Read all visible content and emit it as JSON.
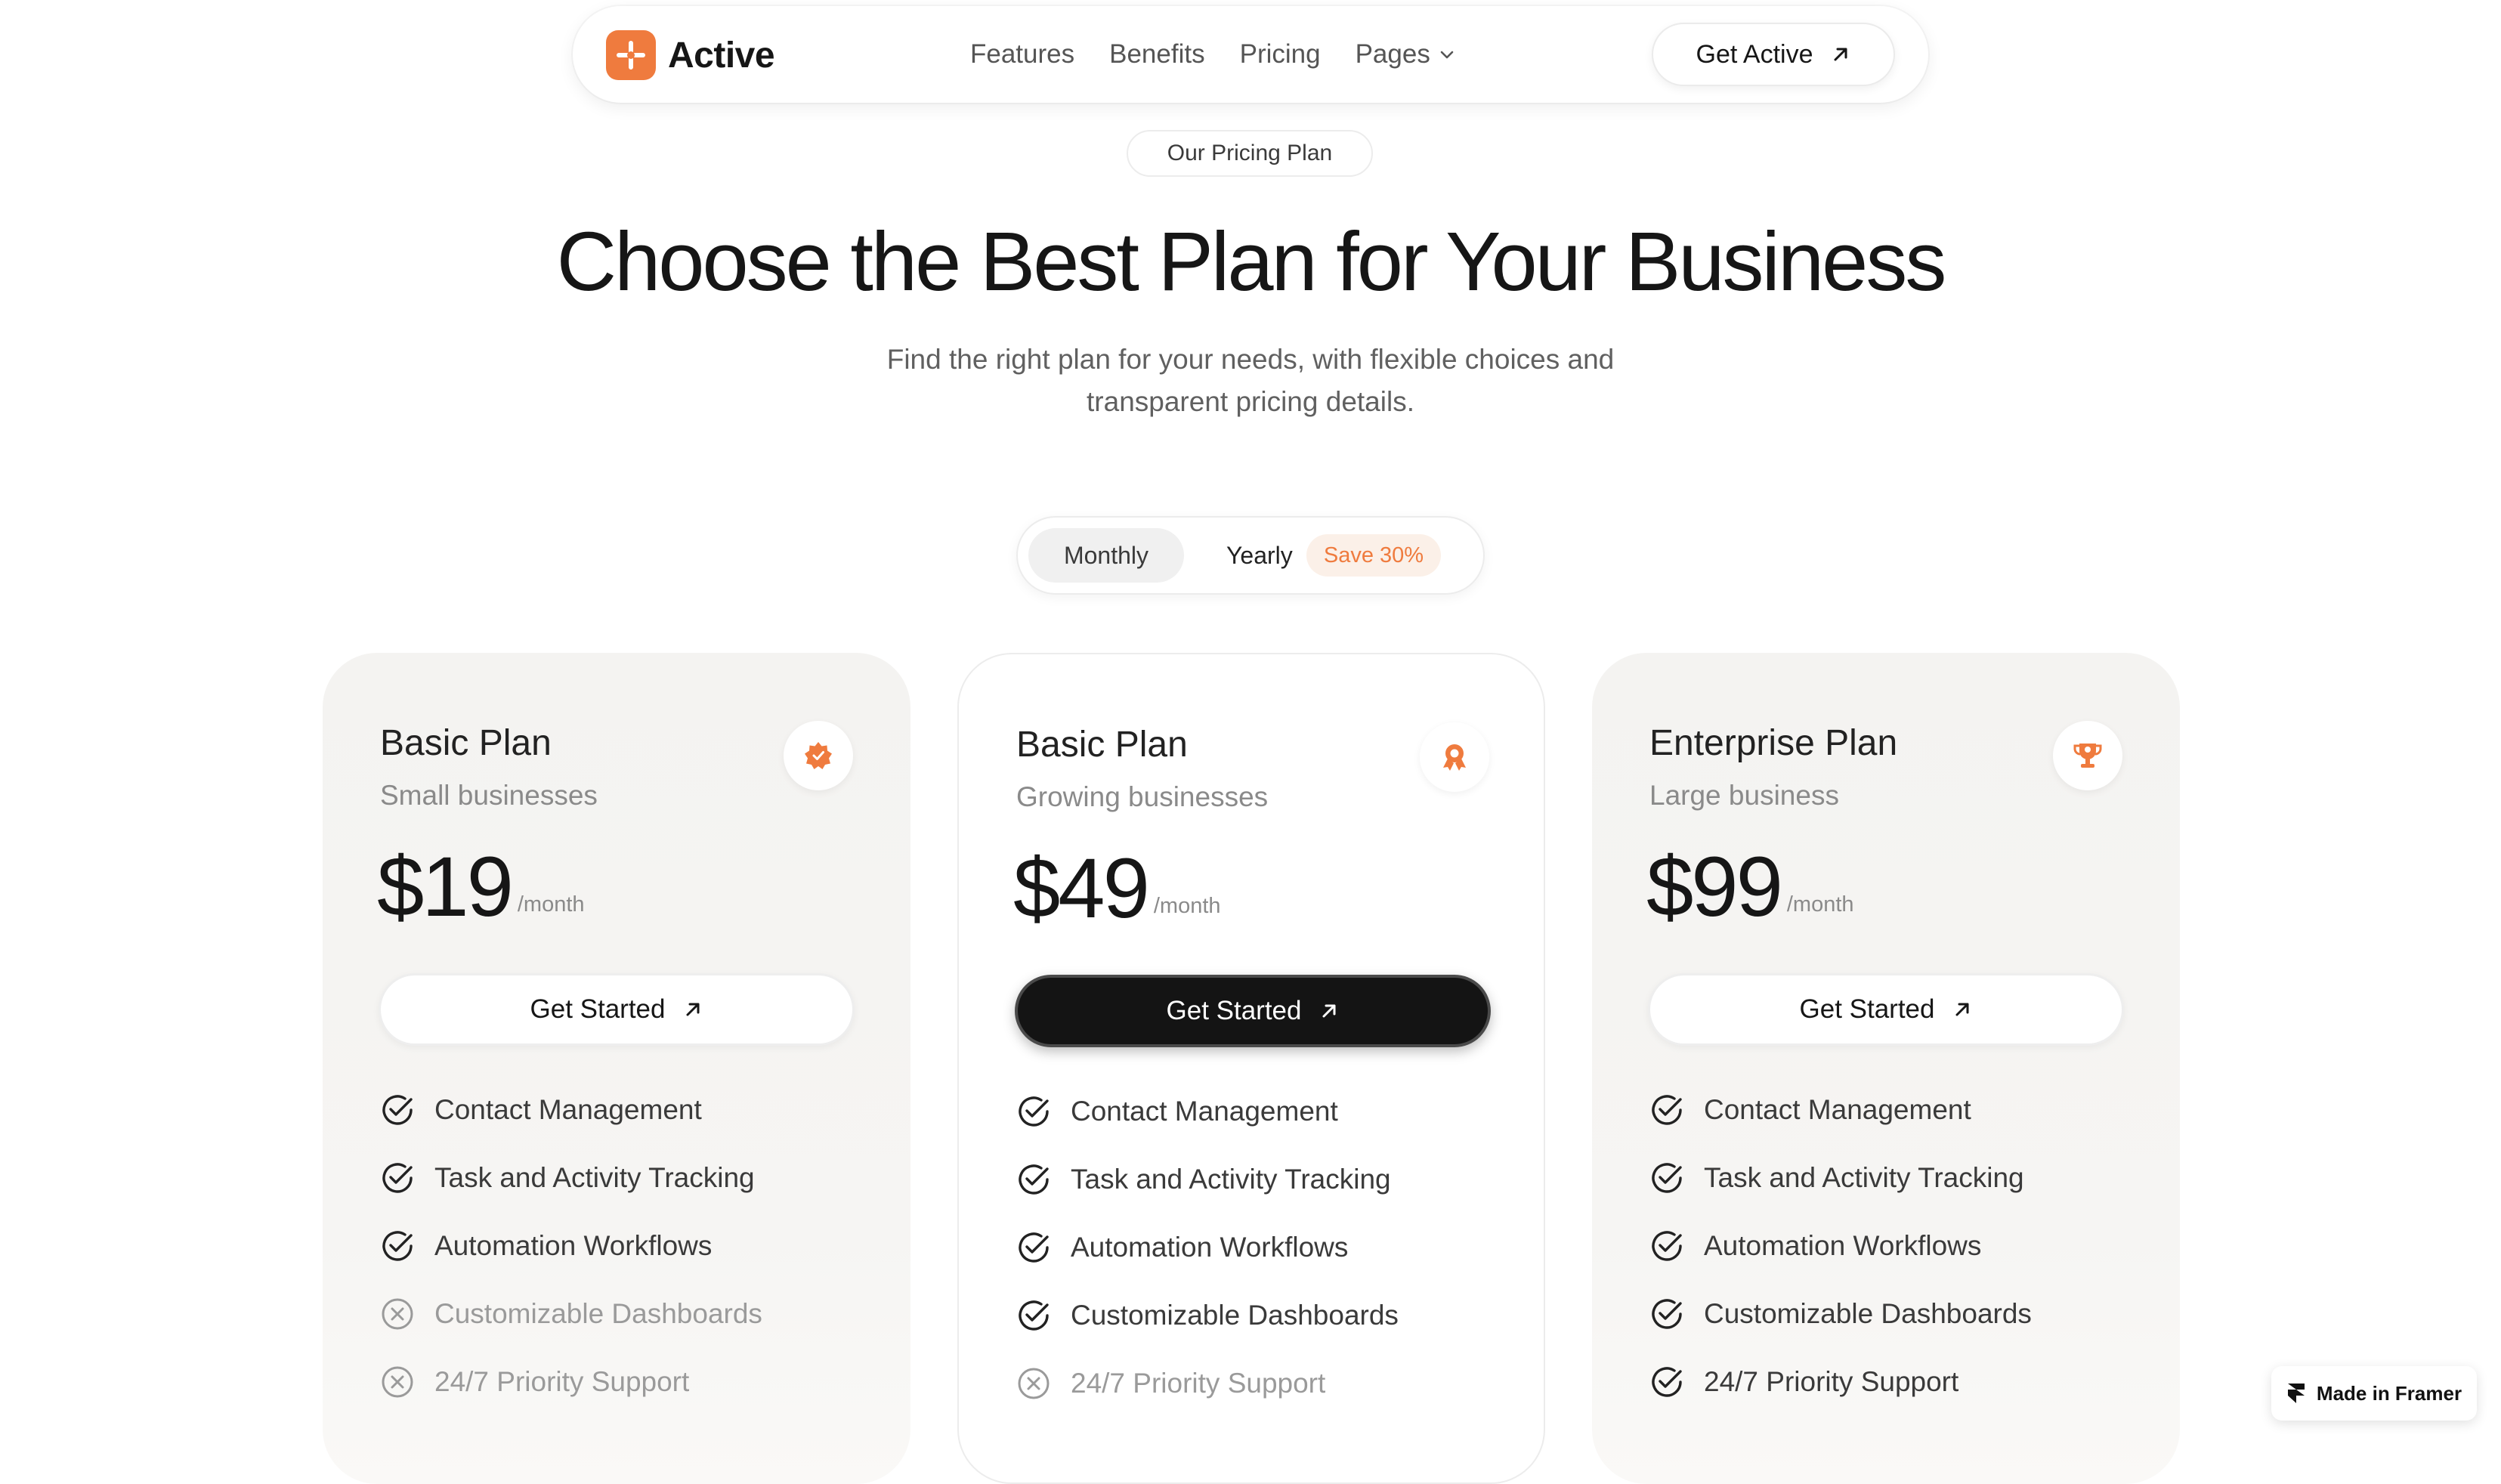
{
  "nav": {
    "brand": "Active",
    "links": [
      "Features",
      "Benefits",
      "Pricing",
      "Pages"
    ],
    "cta_label": "Get Active"
  },
  "hero": {
    "badge": "Our Pricing Plan",
    "title": "Choose the Best Plan for Your Business",
    "subtitle_line1": "Find the right plan for your needs, with flexible choices and",
    "subtitle_line2": "transparent pricing details."
  },
  "toggle": {
    "monthly": "Monthly",
    "yearly": "Yearly",
    "save_badge": "Save 30%",
    "selected": "Monthly"
  },
  "plans": [
    {
      "name": "Basic Plan",
      "audience": "Small businesses",
      "price": "$19",
      "period": "/month",
      "cta": "Get Started",
      "highlighted": false,
      "icon": "badge-icon",
      "features": [
        {
          "label": "Contact Management",
          "included": true
        },
        {
          "label": "Task and Activity Tracking",
          "included": true
        },
        {
          "label": "Automation Workflows",
          "included": true
        },
        {
          "label": "Customizable Dashboards",
          "included": false
        },
        {
          "label": "24/7 Priority Support",
          "included": false
        }
      ]
    },
    {
      "name": "Basic Plan",
      "audience": "Growing businesses",
      "price": "$49",
      "period": "/month",
      "cta": "Get Started",
      "highlighted": true,
      "icon": "award-ribbon-icon",
      "features": [
        {
          "label": "Contact Management",
          "included": true
        },
        {
          "label": "Task and Activity Tracking",
          "included": true
        },
        {
          "label": "Automation Workflows",
          "included": true
        },
        {
          "label": "Customizable Dashboards",
          "included": true
        },
        {
          "label": "24/7 Priority Support",
          "included": false
        }
      ]
    },
    {
      "name": "Enterprise Plan",
      "audience": "Large business",
      "price": "$99",
      "period": "/month",
      "cta": "Get Started",
      "highlighted": false,
      "icon": "trophy-icon",
      "features": [
        {
          "label": "Contact Management",
          "included": true
        },
        {
          "label": "Task and Activity Tracking",
          "included": true
        },
        {
          "label": "Automation Workflows",
          "included": true
        },
        {
          "label": "Customizable Dashboards",
          "included": true
        },
        {
          "label": "24/7 Priority Support",
          "included": true
        }
      ]
    }
  ],
  "framer_badge": "Made in Framer",
  "colors": {
    "accent": "#ef7b3e",
    "text": "#161616",
    "muted": "#8a8a8a",
    "card_gray": "#f4f3f1",
    "dark_button": "#141414"
  }
}
